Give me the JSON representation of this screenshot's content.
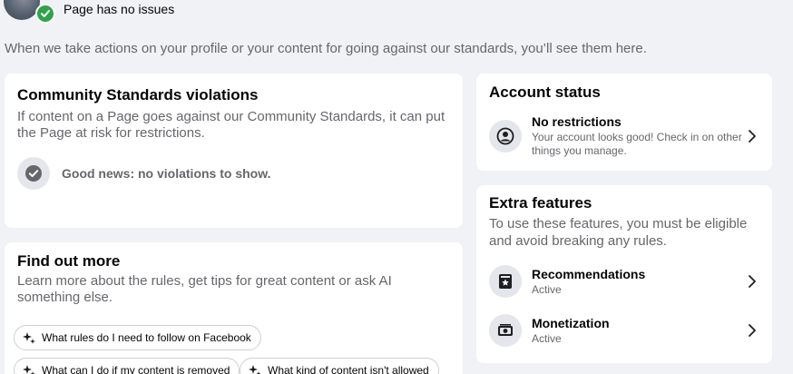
{
  "header": {
    "page_status": "Page has no issues"
  },
  "intro": "When we take actions on your profile or your content for going against our standards, you’ll see them here.",
  "violations": {
    "title": "Community Standards violations",
    "description": "If content on a Page goes against our Community Standards, it can put the Page at risk for restrictions.",
    "good_news": "Good news: no violations to show."
  },
  "account_status": {
    "title": "Account status",
    "item": {
      "title": "No restrictions",
      "subtitle": "Your account looks good! Check in on other things you manage."
    }
  },
  "extra_features": {
    "title": "Extra features",
    "description": "To use these features, you must be eligible and avoid breaking any rules.",
    "items": [
      {
        "title": "Recommendations",
        "status": "Active"
      },
      {
        "title": "Monetization",
        "status": "Active"
      }
    ]
  },
  "find_out_more": {
    "title": "Find out more",
    "description": "Learn more about the rules, get tips for great content or ask AI something else.",
    "chips": [
      "What rules do I need to follow on Facebook",
      "What can I do if my content is removed",
      "What kind of content isn't allowed"
    ]
  },
  "colors": {
    "success": "#31a24c",
    "background": "#f0f2f5",
    "card": "#ffffff",
    "secondary_text": "#65676b"
  }
}
